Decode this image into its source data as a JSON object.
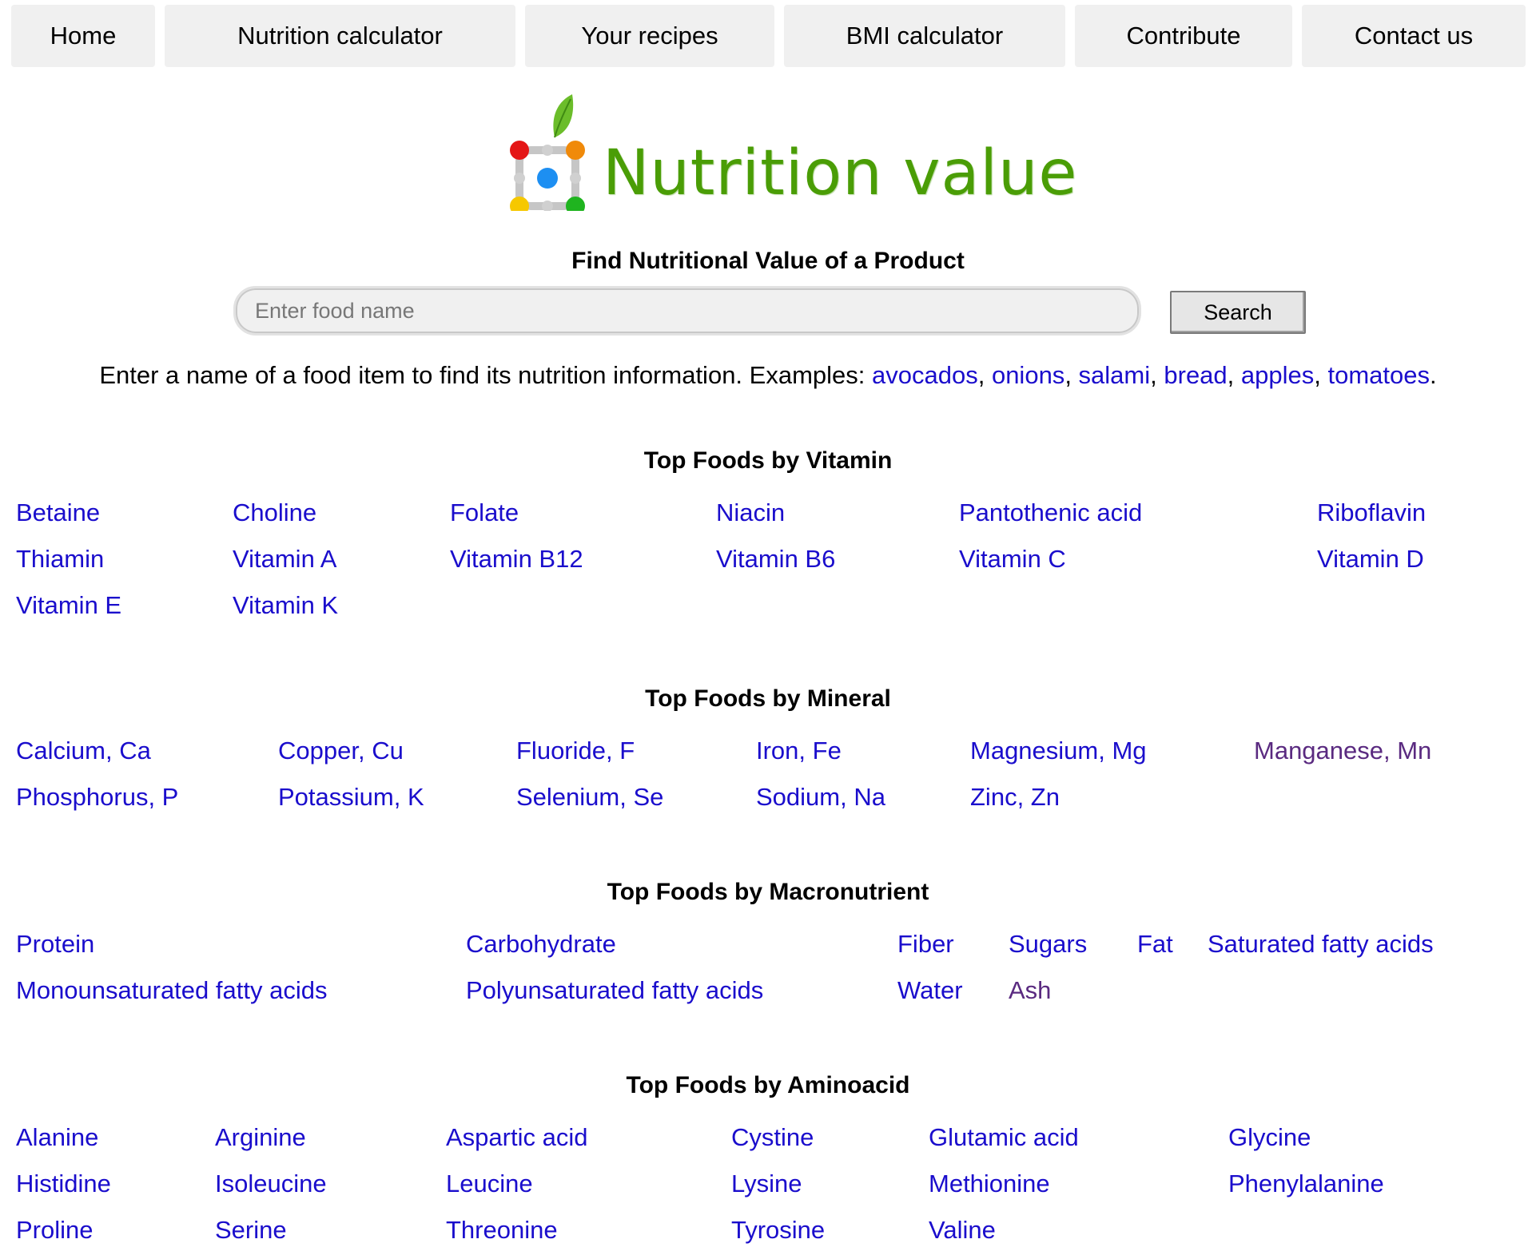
{
  "nav": [
    "Home",
    "Nutrition calculator",
    "Your recipes",
    "BMI calculator",
    "Contribute",
    "Contact us"
  ],
  "logo": {
    "text": "Nutrition value"
  },
  "search": {
    "title": "Find Nutritional Value of a Product",
    "placeholder": "Enter food name",
    "button": "Search",
    "intro": "Enter a name of a food item to find its nutrition information. Examples: ",
    "examples": [
      "avocados",
      "onions",
      "salami",
      "bread",
      "apples",
      "tomatoes"
    ]
  },
  "sections": {
    "vitamin": {
      "title": "Top Foods by Vitamin",
      "items": [
        "Betaine",
        "Choline",
        "Folate",
        "Niacin",
        "Pantothenic acid",
        "Riboflavin",
        "Thiamin",
        "Vitamin A",
        "Vitamin B12",
        "Vitamin B6",
        "Vitamin C",
        "Vitamin D",
        "Vitamin E",
        "Vitamin K"
      ]
    },
    "mineral": {
      "title": "Top Foods by Mineral",
      "items": [
        "Calcium, Ca",
        "Copper, Cu",
        "Fluoride, F",
        "Iron, Fe",
        "Magnesium, Mg",
        "Manganese, Mn",
        "Phosphorus, P",
        "Potassium, K",
        "Selenium, Se",
        "Sodium, Na",
        "Zinc, Zn"
      ]
    },
    "macronutrient": {
      "title": "Top Foods by Macronutrient",
      "items": [
        "Protein",
        "Carbohydrate",
        "Fiber",
        "Sugars",
        "Fat",
        "Saturated fatty acids",
        "Monounsaturated fatty acids",
        "Polyunsaturated fatty acids",
        "Water",
        "Ash"
      ]
    },
    "aminoacid": {
      "title": "Top Foods by Aminoacid",
      "items": [
        "Alanine",
        "Arginine",
        "Aspartic acid",
        "Cystine",
        "Glutamic acid",
        "Glycine",
        "Histidine",
        "Isoleucine",
        "Leucine",
        "Lysine",
        "Methionine",
        "Phenylalanine",
        "Proline",
        "Serine",
        "Threonine",
        "Tyrosine",
        "Valine"
      ]
    }
  },
  "colors": {
    "link": "#1a0dcc",
    "visited_link": "#5a2a80",
    "logo_green": "#4a9d06",
    "nav_bg": "#f0f0f0"
  }
}
